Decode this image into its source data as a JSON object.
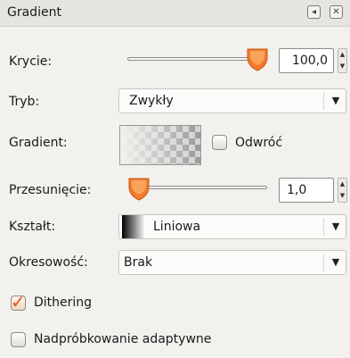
{
  "window": {
    "title": "Gradient",
    "menu_icon": "panel-menu-icon",
    "close_icon": "close-icon"
  },
  "opacity": {
    "label": "Krycie:",
    "value": "100,0",
    "slider_fraction": 1.0
  },
  "mode": {
    "label": "Tryb:",
    "value": "Zwykły"
  },
  "gradient": {
    "label": "Gradient:",
    "reverse_label": "Odwróć",
    "reverse_checked": false
  },
  "offset": {
    "label": "Przesunięcie:",
    "value": "1,0",
    "slider_fraction": 0.0
  },
  "shape": {
    "label": "Kształt:",
    "value": "Liniowa"
  },
  "repeat": {
    "label": "Okresowość:",
    "value": "Brak"
  },
  "dithering": {
    "label": "Dithering",
    "checked": true
  },
  "supersampling": {
    "label": "Nadpróbkowanie adaptywne",
    "checked": false
  },
  "colors": {
    "thumb": "#f47a2c",
    "accent": "#e0561a"
  }
}
